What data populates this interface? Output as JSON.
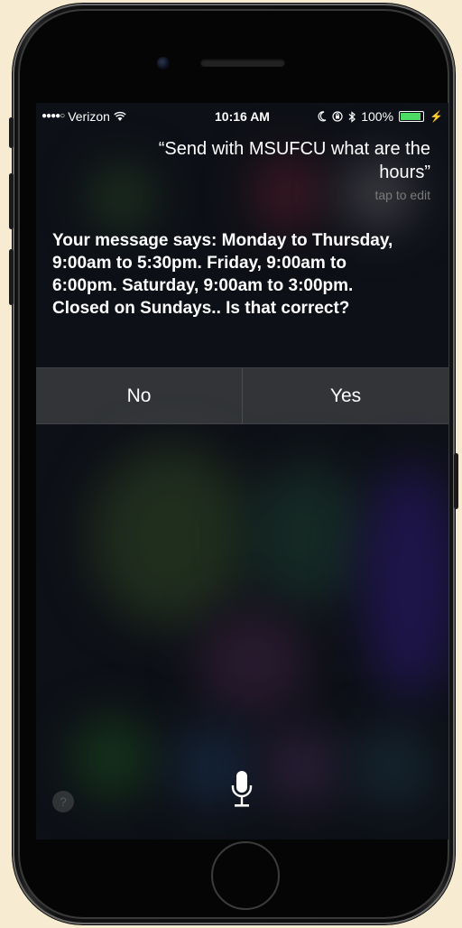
{
  "status_bar": {
    "signal": "●●●●○",
    "carrier": "Verizon",
    "time": "10:16 AM",
    "battery_percent": "100%",
    "battery_level": 1.0,
    "icons": [
      "wifi-icon",
      "moon-icon",
      "rotation-lock-icon",
      "bluetooth-icon",
      "battery-icon",
      "charging-icon"
    ]
  },
  "siri": {
    "query": "“Send with MSUFCU what are the hours”",
    "tap_to_edit": "tap to edit",
    "response": "Your message says: Monday to Thursday, 9:00am to 5:30pm. Friday, 9:00am to 6:00pm. Saturday, 9:00am to 3:00pm. Closed on Sundays.. Is that correct?",
    "no_label": "No",
    "yes_label": "Yes",
    "help_label": "?"
  },
  "colors": {
    "page_background": "#f7ecd2",
    "battery_green": "#4cd964",
    "text": "#ffffff",
    "muted": "#7a7a7a"
  }
}
